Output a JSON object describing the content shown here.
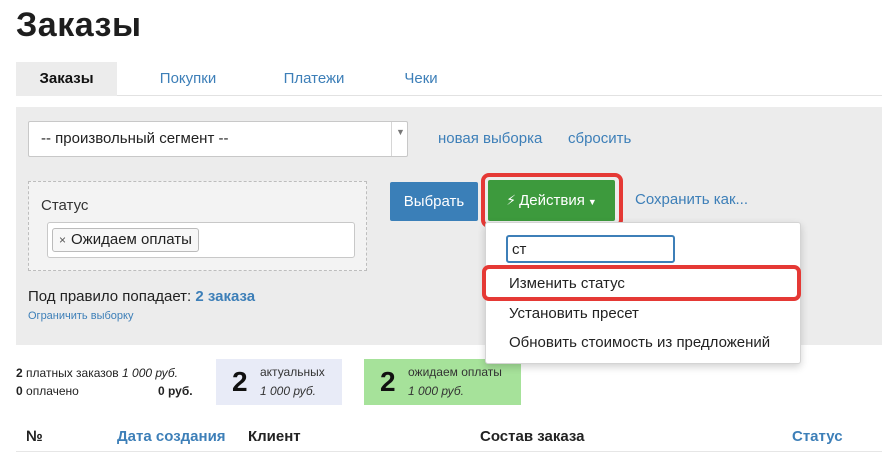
{
  "page": {
    "title": "Заказы"
  },
  "tabs": [
    {
      "label": "Заказы",
      "active": true
    },
    {
      "label": "Покупки",
      "active": false
    },
    {
      "label": "Платежи",
      "active": false
    },
    {
      "label": "Чеки",
      "active": false
    }
  ],
  "filter": {
    "segment_value": "-- произвольный сегмент --",
    "new_selection_link": "новая выборка",
    "reset_link": "сбросить",
    "status_label": "Статус",
    "status_tag_remove": "×",
    "status_tag": "Ожидаем оплаты",
    "rule_prefix": "Под правило попадает:",
    "rule_count": "2 заказа",
    "limit_link": "Ограничить выборку",
    "select_button": "Выбрать",
    "actions_button": "Действия",
    "save_as_link": "Сохранить как..."
  },
  "actions_menu": {
    "search_value": "ст",
    "items": [
      "Изменить статус",
      "Установить пресет",
      "Обновить стоимость из предложений"
    ]
  },
  "summary": {
    "paid_count": "2",
    "paid_text": "платных заказов",
    "paid_amount": "1 000 руб.",
    "paid_done_count": "0",
    "paid_done_text": "оплачено",
    "paid_done_amount": "0 руб.",
    "actual_count": "2",
    "actual_label": "актуальных",
    "actual_sum": "1 000 руб.",
    "waiting_count": "2",
    "waiting_label": "ожидаем оплаты",
    "waiting_sum": "1 000 руб."
  },
  "table": {
    "columns": [
      "№",
      "Дата создания",
      "Клиент",
      "Состав заказа",
      "Статус"
    ]
  },
  "colors": {
    "link": "#3d7fb8",
    "primary_button": "#3a7fb8",
    "actions_button": "#3d9a3d",
    "highlight": "#e53935",
    "actual_card": "#e8ebf7",
    "waiting_card": "#a6e29a"
  }
}
